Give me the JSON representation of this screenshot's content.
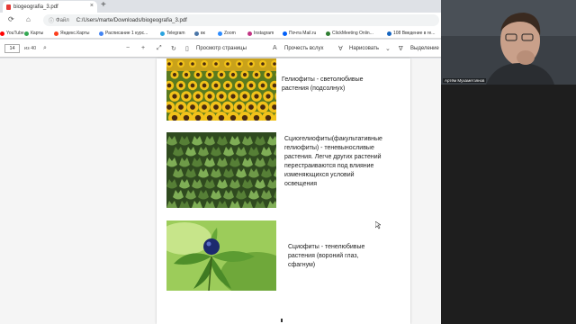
{
  "browser": {
    "tab_title": "biogeografia_3.pdf",
    "tab_close": "×",
    "new_tab": "+",
    "address": {
      "scheme_label": "Файл",
      "url": "C:/Users/marte/Downloads/biogeografia_3.pdf"
    }
  },
  "bookmarks": [
    {
      "label": "YouTube",
      "color": "#ff0000"
    },
    {
      "label": "Карты",
      "color": "#34a853"
    },
    {
      "label": "Яндекс.Карты",
      "color": "#fc3f1d"
    },
    {
      "label": "Расписание 1 курс...",
      "color": "#4285f4"
    },
    {
      "label": "Telegram",
      "color": "#2aa3df"
    },
    {
      "label": "вк",
      "color": "#4a76a8"
    },
    {
      "label": "Zoom",
      "color": "#2d8cff"
    },
    {
      "label": "Instagram",
      "color": "#c13584"
    },
    {
      "label": "Почта Mail.ru",
      "color": "#005ff9"
    },
    {
      "label": "ClickMeeting Onlin...",
      "color": "#2e7d32"
    },
    {
      "label": "108 Введение в ге...",
      "color": "#1565c0"
    }
  ],
  "pdf_toolbar": {
    "page_current": "14",
    "page_of": "из 40",
    "zoom_out": "−",
    "zoom_in": "+",
    "page_view_label": "Просмотр страницы",
    "read_aloud_label": "Прочесть вслух",
    "draw_label": "Нарисовать",
    "highlight_label": "Выделение"
  },
  "page": {
    "item1": "Гелиофиты - светолюбивые растения (подсолнух)",
    "item2": "Сциогелиофиты(факультативные гелиофиты) - теневыносливые растения. Легче других растений перестраиваются под влияние изменяющихся условий освещения",
    "item3": "Сциофиты - тенелюбивые растения (вороний глаз, сфагнум)"
  },
  "webcam": {
    "participant_name": "Артём Мухаметзянов"
  }
}
